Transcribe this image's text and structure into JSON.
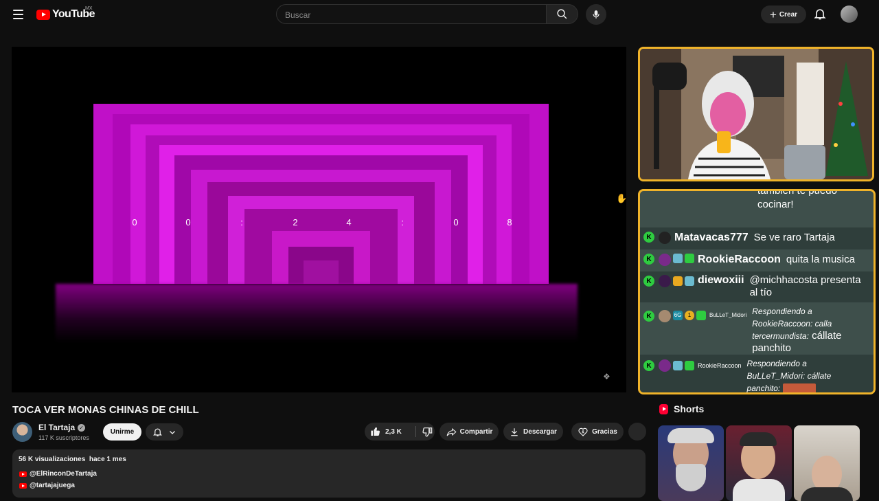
{
  "masthead": {
    "logo_text": "YouTube",
    "country_code": "MX",
    "search_placeholder": "Buscar",
    "create_label": "Crear",
    "icons": [
      "menu-icon",
      "search-icon",
      "mic-icon",
      "plus-icon",
      "bell-icon"
    ]
  },
  "player": {
    "timer_chars": [
      "0",
      "0",
      ":",
      "2",
      "4",
      ":",
      "0",
      "8"
    ]
  },
  "chat": {
    "messages": [
      {
        "user": "",
        "text": "también te puedo cocinar!"
      },
      {
        "user": "Matavacas777",
        "text": "Se ve raro Tartaja"
      },
      {
        "user": "RookieRaccoon",
        "text": "quita la musica"
      },
      {
        "user": "diewoxiii",
        "text": "@michhacosta presenta al tío"
      },
      {
        "user": "BuLLeT_Midori",
        "reply_to": "Respondiendo a RookieRaccoon: calla tercermundista:",
        "text": "cállate panchito"
      },
      {
        "user": "RookieRaccoon",
        "reply_to": "Respondiendo a BuLLeT_Midori: cállate panchito:",
        "text": ""
      }
    ],
    "badge_letter": "K",
    "badge_number": "1",
    "badge_tag": "6G"
  },
  "video": {
    "title": "TOCA VER MONAS CHINAS DE CHILL",
    "channel_name": "El Tartaja",
    "subscribers": "117 K suscriptores",
    "join_label": "Unirme",
    "likes": "2,3 K",
    "share_label": "Compartir",
    "download_label": "Descargar",
    "thanks_label": "Gracias",
    "views": "56 K visualizaciones",
    "age": "hace 1 mes",
    "links": [
      "@ElRinconDeTartaja",
      "@tartajajuega"
    ]
  },
  "shorts": {
    "heading": "Shorts"
  },
  "colors": {
    "accent_border": "#f0b32a",
    "brand_red": "#ff0000",
    "viz_magenta": "#c000c0"
  }
}
